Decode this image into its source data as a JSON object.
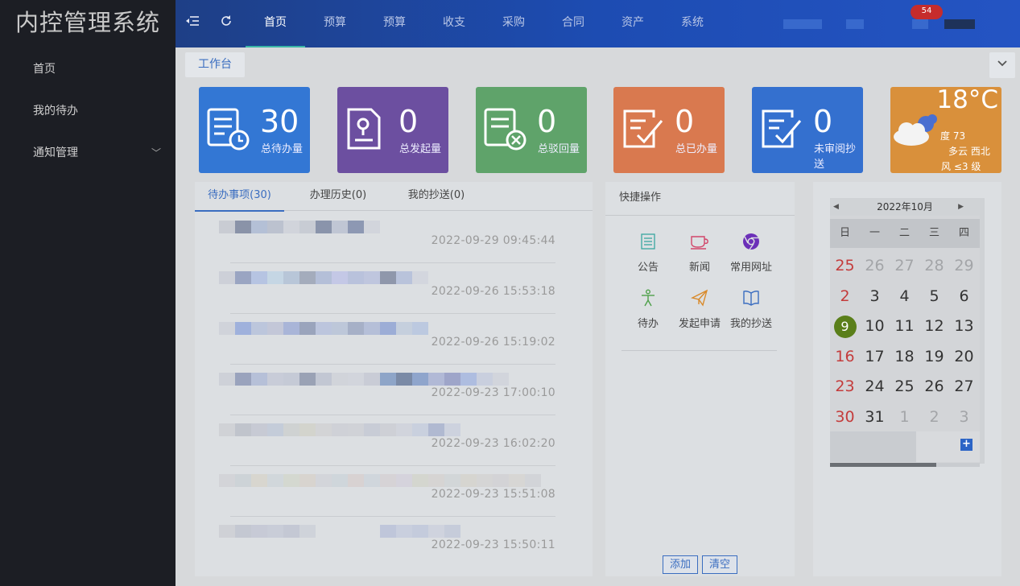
{
  "app": {
    "title": "内控管理系统"
  },
  "sidebar": {
    "items": [
      {
        "label": "首页"
      },
      {
        "label": "我的待办"
      },
      {
        "label": "通知管理",
        "chevron": "chevron-down-icon"
      }
    ]
  },
  "topbar": {
    "nav": [
      {
        "label": "首页",
        "active": true
      },
      {
        "label": "预算"
      },
      {
        "label": "预算"
      },
      {
        "label": "收支"
      },
      {
        "label": "采购"
      },
      {
        "label": "合同"
      },
      {
        "label": "资产"
      },
      {
        "label": "系统"
      }
    ],
    "badge": "54",
    "colors": {
      "bar": "#1d4cb2",
      "active_underline": "#3bb6a7"
    }
  },
  "tagbar": {
    "tag": "工作台",
    "collapse_icon": "chevron-down-icon"
  },
  "stats": [
    {
      "value": "30",
      "label": "总待办量",
      "color": "#3377d4",
      "icon": "todo-clock-icon"
    },
    {
      "value": "0",
      "label": "总发起量",
      "color": "#6c4fa0",
      "icon": "document-location-icon"
    },
    {
      "value": "0",
      "label": "总驳回量",
      "color": "#5fa36a",
      "icon": "document-reject-icon"
    },
    {
      "value": "0",
      "label": "总已办量",
      "color": "#d9794f",
      "icon": "document-check-icon"
    },
    {
      "value": "0",
      "label": "未审阅抄送",
      "color": "#3470cf",
      "icon": "document-check-icon"
    }
  ],
  "weather": {
    "temp": "18°C",
    "humidity": "度 73",
    "condition": "多云 西北",
    "wind": "风 ≤3 级",
    "icon": "cloud-icon"
  },
  "todo": {
    "tabs": [
      {
        "label": "待办事项(30)",
        "active": true
      },
      {
        "label": "办理历史(0)"
      },
      {
        "label": "我的抄送(0)"
      }
    ],
    "rows": [
      {
        "time": "2022-09-29 09:45:44"
      },
      {
        "time": "2022-09-26 15:53:18"
      },
      {
        "time": "2022-09-26 15:19:02"
      },
      {
        "time": "2022-09-23 17:00:10"
      },
      {
        "time": "2022-09-23 16:02:20"
      },
      {
        "time": "2022-09-23 15:51:08"
      },
      {
        "time": "2022-09-23 15:50:11"
      }
    ]
  },
  "quick": {
    "title": "快捷操作",
    "items": [
      {
        "label": "公告",
        "icon": "list-icon",
        "color": "#3aa7a0"
      },
      {
        "label": "新闻",
        "icon": "cup-icon",
        "color": "#d2466a"
      },
      {
        "label": "常用网址",
        "icon": "chrome-icon",
        "color": "#6b2fb8"
      },
      {
        "label": "待办",
        "icon": "person-icon",
        "color": "#4fa04a"
      },
      {
        "label": "发起申请",
        "icon": "paper-plane-icon",
        "color": "#d98a2b"
      },
      {
        "label": "我的抄送",
        "icon": "book-icon",
        "color": "#3a6dc0"
      }
    ],
    "add_label": "添加",
    "clear_label": "清空"
  },
  "calendar": {
    "title": "2022年10月",
    "weekdays": [
      "日",
      "一",
      "二",
      "三",
      "四"
    ],
    "weeks": [
      [
        {
          "d": "25",
          "t": "red"
        },
        {
          "d": "26",
          "t": "grey"
        },
        {
          "d": "27",
          "t": "grey"
        },
        {
          "d": "28",
          "t": "grey"
        },
        {
          "d": "29",
          "t": "grey"
        }
      ],
      [
        {
          "d": "2",
          "t": "red"
        },
        {
          "d": "3"
        },
        {
          "d": "4"
        },
        {
          "d": "5"
        },
        {
          "d": "6"
        }
      ],
      [
        {
          "d": "9",
          "t": "today"
        },
        {
          "d": "10"
        },
        {
          "d": "11"
        },
        {
          "d": "12"
        },
        {
          "d": "13"
        }
      ],
      [
        {
          "d": "16",
          "t": "red"
        },
        {
          "d": "17"
        },
        {
          "d": "18"
        },
        {
          "d": "19"
        },
        {
          "d": "20"
        }
      ],
      [
        {
          "d": "23",
          "t": "red"
        },
        {
          "d": "24"
        },
        {
          "d": "25"
        },
        {
          "d": "26"
        },
        {
          "d": "27"
        }
      ],
      [
        {
          "d": "30",
          "t": "red"
        },
        {
          "d": "31"
        },
        {
          "d": "1",
          "t": "grey"
        },
        {
          "d": "2",
          "t": "grey"
        },
        {
          "d": "3",
          "t": "grey"
        }
      ]
    ],
    "add_icon": "plus-icon"
  }
}
